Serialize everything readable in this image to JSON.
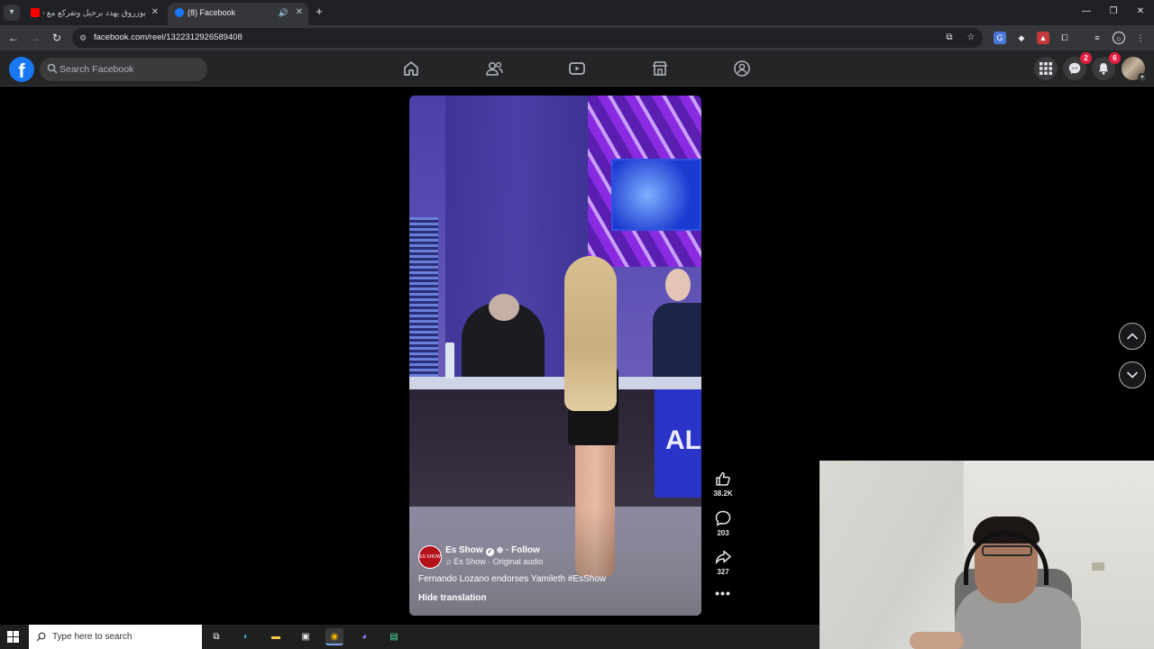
{
  "browser": {
    "tabs": [
      {
        "title": "بوزروق يهدد برحيل وتفركع مع فنا",
        "active": false
      },
      {
        "title": "(8) Facebook",
        "active": true
      }
    ],
    "url": "facebook.com/reel/1322312926589408"
  },
  "facebook": {
    "search_placeholder": "Search Facebook",
    "messenger_badge": "2",
    "notifications_badge": "6"
  },
  "reel": {
    "channel_name": "Es Show",
    "follow_label": "Follow",
    "audio_label": "Es Show · Original audio",
    "caption": "Fernando Lozano endorses Yamileth #EsShow",
    "hide_translation_label": "Hide translation",
    "video_overlay_text": "AL",
    "channel_logo_text": "ES SHOW",
    "likes": "38.2K",
    "comments": "203",
    "shares": "327"
  },
  "taskbar": {
    "search_placeholder": "Type here to search"
  },
  "colors": {
    "fb_blue": "#1877f2",
    "fb_header": "#242526",
    "badge_red": "#e41e3f",
    "browser_dark": "#202124"
  }
}
